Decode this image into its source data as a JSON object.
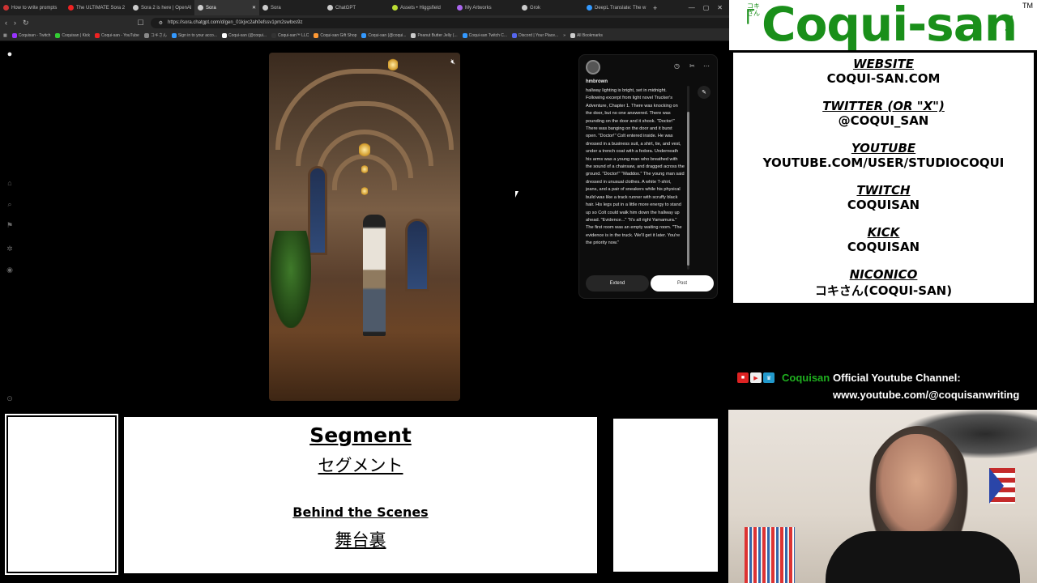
{
  "browser": {
    "tabs": [
      {
        "label": "How to write prompts",
        "color": "#c33"
      },
      {
        "label": "The ULTIMATE Sora 2",
        "color": "#e22"
      },
      {
        "label": "Sora 2 is here | OpenAI",
        "color": "#ccc"
      },
      {
        "label": "Sora",
        "color": "#ccc",
        "active": true
      },
      {
        "label": "Sora",
        "color": "#ccc"
      },
      {
        "label": "ChatGPT",
        "color": "#ccc"
      },
      {
        "label": "Assets • Higgsfield",
        "color": "#bd3"
      },
      {
        "label": "My Artworks",
        "color": "#a6e"
      },
      {
        "label": "Grok",
        "color": "#ccc"
      },
      {
        "label": "DeepL Translate: The w",
        "color": "#39f"
      }
    ],
    "url": "https://sora.chatgpt.com/d/gen_01kjvc2ah0efssv1pm2swbxs9z",
    "bookmarks": [
      {
        "label": "Coquisan - Twitch",
        "color": "#93f"
      },
      {
        "label": "Coquisan | Kick",
        "color": "#3c3"
      },
      {
        "label": "Coqui-san - YouTube",
        "color": "#e22"
      },
      {
        "label": "コキさん",
        "color": "#888"
      },
      {
        "label": "Sign in to your acco...",
        "color": "#39f"
      },
      {
        "label": "Coqui-san (@coqui...",
        "color": "#fff"
      },
      {
        "label": "Coqui-san™ LLC",
        "color": "#333"
      },
      {
        "label": "Coqui-san Gift Shop",
        "color": "#f93"
      },
      {
        "label": "Coqui-san (@coqui...",
        "color": "#39f"
      },
      {
        "label": "Peanut Butter Jelly (...",
        "color": "#ccc"
      },
      {
        "label": "Coqui-san Twitch C...",
        "color": "#39f"
      },
      {
        "label": "Discord | Your Place...",
        "color": "#56e"
      },
      {
        "label": "All Bookmarks",
        "color": "#ccc"
      }
    ]
  },
  "sora": {
    "username": "hmbrown",
    "prompt": "hallway lighting is bright, set in midnight. Following excerpt from light novel Trucker's Adventure, Chapter 1. There was knocking on the door, but no one answered. There was pounding on the door and it shook. \"Doctor!\" There was banging on the door and it burst open. \"Doctor!\" Colt entered inside. He was dressed in a business suit, a shirt, tie, and vest, under a trench coat with a fedora. Underneath his arms was a young man who breathed with the sound of a chainsaw, and dragged across the ground. \"Doctor!\" \"Maddox.\" The young man said dressed in unusual clothes. A white T-shirt, jeans, and a pair of sneakers while his physical build was like a track runner with scruffy black hair. His legs put in a little more energy to stand up so Colt could walk him down the hallway up ahead. \"Evidence...\" \"It's all right Yamamura.\" The first room was an empty waiting room. \"The evidence is in the truck. We'll get it later. You're the priority now.\"",
    "extend_label": "Extend",
    "post_label": "Post"
  },
  "info": {
    "logo": "Coqui-san",
    "logo_kana": "コキさん",
    "logo_open": "「",
    "logo_close": "」",
    "tm": "TM",
    "sections": [
      {
        "heading": "WEBSITE",
        "value": "COQUI-SAN.COM"
      },
      {
        "heading": "TWITTER (OR \"X\")",
        "value": "@COQUI_SAN"
      },
      {
        "heading": "YOUTUBE",
        "value": "YOUTUBE.COM/USER/STUDIOCOQUI"
      },
      {
        "heading": "TWITCH",
        "value": "COQUISAN"
      },
      {
        "heading": "KICK",
        "value": "COQUISAN"
      },
      {
        "heading": "NICONICO",
        "value": "コキさん(COQUI-SAN)"
      }
    ]
  },
  "channel": {
    "name": "Coquisan",
    "title": "Official Youtube Channel:",
    "url": "www.youtube.com/@coquisanwriting"
  },
  "segment": {
    "title": "Segment",
    "title_kana": "セグメント",
    "subtitle": "Behind the Scenes",
    "subtitle_kana": "舞台裏"
  }
}
